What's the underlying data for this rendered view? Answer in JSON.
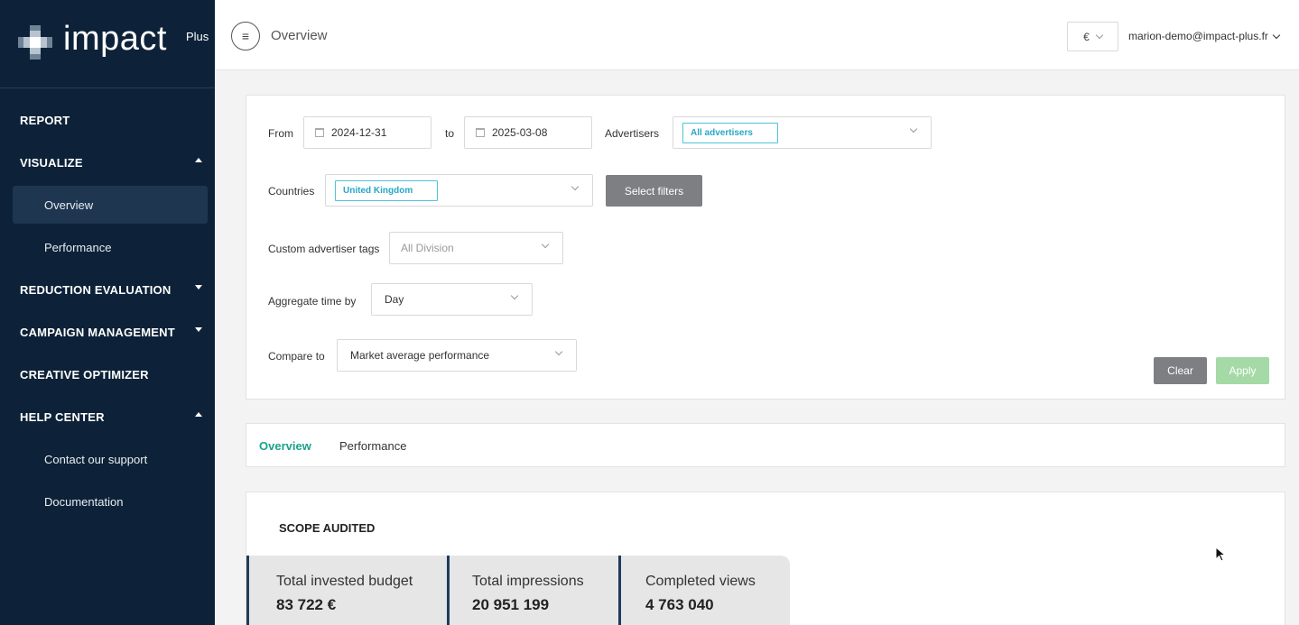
{
  "brand": {
    "name": "impact",
    "suffix": "Plus"
  },
  "nav": {
    "report": "REPORT",
    "visualize": "VISUALIZE",
    "overview": "Overview",
    "performance": "Performance",
    "reduction": "REDUCTION EVALUATION",
    "campaign": "CAMPAIGN MANAGEMENT",
    "creative": "CREATIVE OPTIMIZER",
    "help": "HELP CENTER",
    "contact": "Contact our support",
    "documentation": "Documentation"
  },
  "header": {
    "menu_icon": "≡",
    "title": "Overview",
    "currency": "€",
    "user": "marion-demo@impact-plus.fr"
  },
  "filters": {
    "from_label": "From",
    "from_value": "2024-12-31",
    "to_label": "to",
    "to_value": "2025-03-08",
    "advertisers_label": "Advertisers",
    "advertisers_tag": "All advertisers",
    "countries_label": "Countries",
    "countries_tag": "United Kingdom",
    "select_filters": "Select filters",
    "tags_label": "Custom advertiser tags",
    "tags_placeholder": "All Division",
    "aggregate_label": "Aggregate time by",
    "aggregate_value": "Day",
    "compare_label": "Compare to",
    "compare_value": "Market average performance",
    "clear": "Clear",
    "apply": "Apply"
  },
  "tabs": {
    "overview": "Overview",
    "performance": "Performance"
  },
  "scope": {
    "title": "SCOPE AUDITED",
    "stats": [
      {
        "label": "Total invested budget",
        "value": "83 722 €"
      },
      {
        "label": "Total impressions",
        "value": "20 951 199"
      },
      {
        "label": "Completed views",
        "value": "4 763 040"
      }
    ]
  },
  "colors": {
    "sidebar_bg": "#0d2238",
    "accent_green": "#1aa38a",
    "tag_cyan": "#27a7c6",
    "apply_disabled": "#a5d9a6",
    "clear_grey": "#7d7f82"
  }
}
